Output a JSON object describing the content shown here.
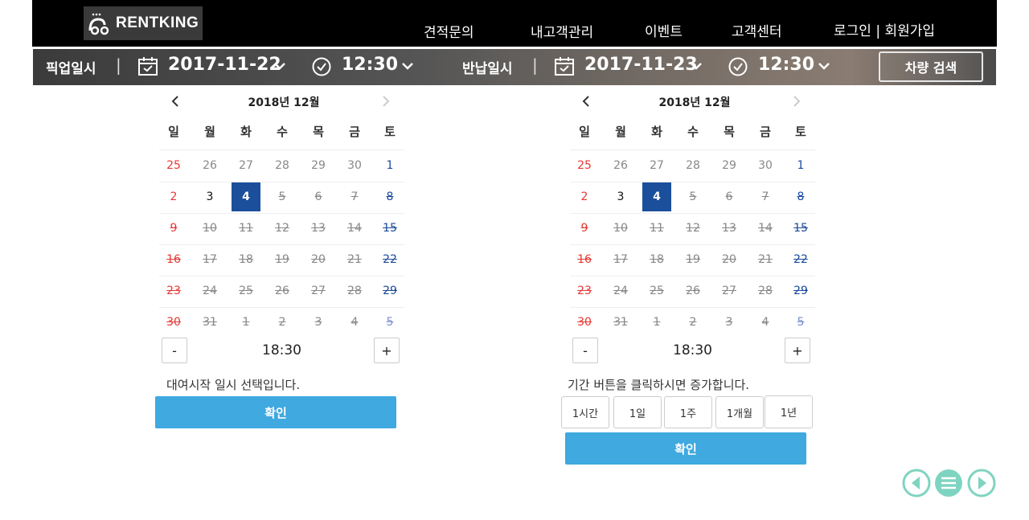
{
  "header": {
    "logo_text": "RENTKING",
    "nav": [
      {
        "label": "견적문의"
      },
      {
        "label": "내고객관리"
      },
      {
        "label": "이벤트"
      },
      {
        "label": "고객센터"
      },
      {
        "label": "로그인 | 회원가입"
      }
    ]
  },
  "search": {
    "pickup_label": "픽업일시",
    "pickup_date": "2017-11-22",
    "pickup_time": "12:30",
    "return_label": "반납일시",
    "return_date": "2017-11-23",
    "return_time": "12:30",
    "separator": "|",
    "search_button": "차량 검색"
  },
  "calendars": [
    {
      "title": "2018년 12월",
      "weekdays": [
        "일",
        "월",
        "화",
        "수",
        "목",
        "금",
        "토"
      ],
      "weeks": [
        [
          "25",
          "26",
          "27",
          "28",
          "29",
          "30",
          "1"
        ],
        [
          "2",
          "3",
          "4",
          "5",
          "6",
          "7",
          "8"
        ],
        [
          "9",
          "10",
          "11",
          "12",
          "13",
          "14",
          "15"
        ],
        [
          "16",
          "17",
          "18",
          "19",
          "20",
          "21",
          "22"
        ],
        [
          "23",
          "24",
          "25",
          "26",
          "27",
          "28",
          "29"
        ],
        [
          "30",
          "31",
          "1",
          "2",
          "3",
          "4",
          "5"
        ]
      ],
      "selected": "4",
      "time": "18:30",
      "minus": "-",
      "plus": "+",
      "message": "대여시작 일시 선택입니다.",
      "confirm": "확인"
    },
    {
      "title": "2018년 12월",
      "weekdays": [
        "일",
        "월",
        "화",
        "수",
        "목",
        "금",
        "토"
      ],
      "weeks": [
        [
          "25",
          "26",
          "27",
          "28",
          "29",
          "30",
          "1"
        ],
        [
          "2",
          "3",
          "4",
          "5",
          "6",
          "7",
          "8"
        ],
        [
          "9",
          "10",
          "11",
          "12",
          "13",
          "14",
          "15"
        ],
        [
          "16",
          "17",
          "18",
          "19",
          "20",
          "21",
          "22"
        ],
        [
          "23",
          "24",
          "25",
          "26",
          "27",
          "28",
          "29"
        ],
        [
          "30",
          "31",
          "1",
          "2",
          "3",
          "4",
          "5"
        ]
      ],
      "selected": "4",
      "time": "18:30",
      "minus": "-",
      "plus": "+",
      "message": "기간 버튼을 클릭하시면 증가합니다.",
      "period_buttons": [
        "1시간",
        "1일",
        "1주",
        "1개월",
        "1년"
      ],
      "confirm": "확인"
    }
  ],
  "colors": {
    "accent": "#3fa9e0",
    "selected": "#1b4f9c",
    "sunday": "#e53935",
    "saturday": "#1a4a9a",
    "fab": "#7fd4c1"
  },
  "icons": {
    "prev_month": "chevron-left-icon",
    "next_month": "chevron-right-icon",
    "calendar": "calendar-icon",
    "clock": "clock-icon",
    "dropdown": "chevron-down-icon",
    "fab_prev": "circle-prev-icon",
    "fab_menu": "circle-menu-icon",
    "fab_next": "circle-next-icon"
  }
}
